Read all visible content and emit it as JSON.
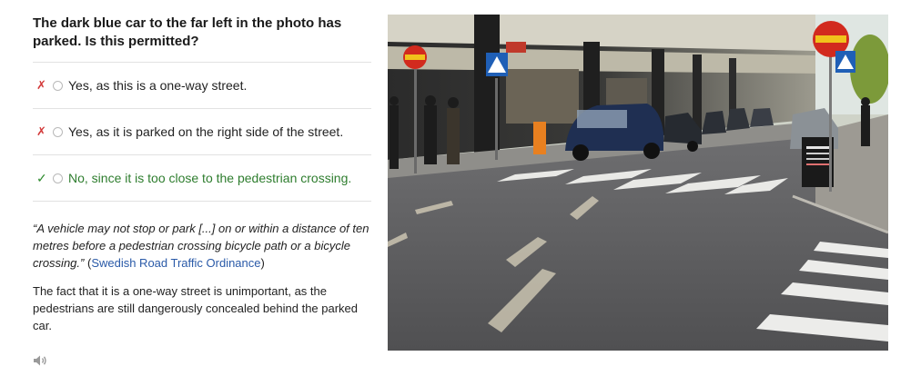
{
  "question": "The dark blue car to the far left in the photo has parked. Is this permitted?",
  "options": [
    {
      "status": "wrong",
      "mark": "✗",
      "label": "Yes, as this is a one-way street."
    },
    {
      "status": "wrong",
      "mark": "✗",
      "label": "Yes, as it is parked on the right side of the street."
    },
    {
      "status": "correct",
      "mark": "✓",
      "label": "No, since it is too close to the pedestrian crossing."
    }
  ],
  "quote": {
    "text": "“A vehicle may not stop or park [...] on or within a distance of ten metres before a pedestrian crossing bicycle path or a bicycle crossing.”",
    "source_open": " (",
    "source_link": "Swedish Road Traffic Ordinance",
    "source_close": ")"
  },
  "explanation": "The fact that it is a one-way street is unimportant, as the pedestrians are still dangerously concealed behind the parked car.",
  "audio": {
    "icon": "speaker-icon"
  },
  "colors": {
    "wrong": "#d33a3a",
    "correct": "#2e7d2e",
    "link": "#2a5aa8"
  }
}
